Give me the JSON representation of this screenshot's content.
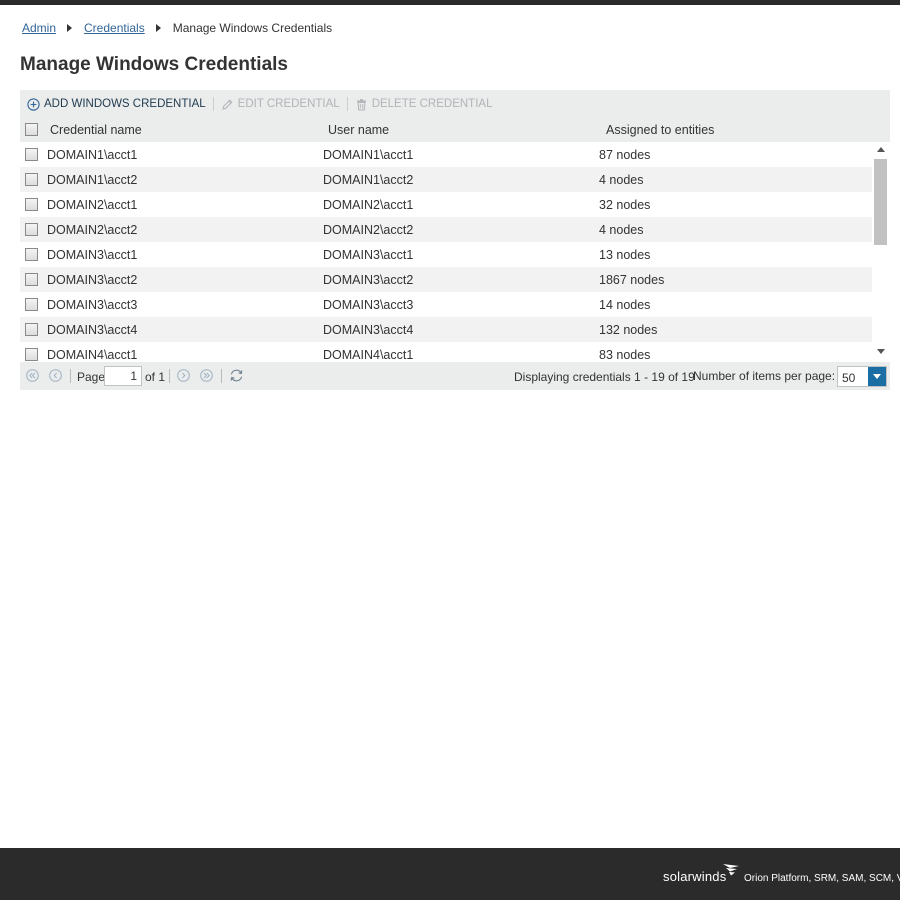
{
  "breadcrumb": {
    "items": [
      "Admin",
      "Credentials"
    ],
    "current": "Manage Windows Credentials"
  },
  "page_title": "Manage Windows Credentials",
  "toolbar": {
    "add_label": "ADD WINDOWS CREDENTIAL",
    "edit_label": "EDIT CREDENTIAL",
    "delete_label": "DELETE CREDENTIAL"
  },
  "columns": [
    "Credential name",
    "User name",
    "Assigned to entities"
  ],
  "rows": [
    {
      "credential": "DOMAIN1\\acct1",
      "user": "DOMAIN1\\acct1",
      "assigned": "87 nodes"
    },
    {
      "credential": "DOMAIN1\\acct2",
      "user": "DOMAIN1\\acct2",
      "assigned": "4 nodes"
    },
    {
      "credential": "DOMAIN2\\acct1",
      "user": "DOMAIN2\\acct1",
      "assigned": "32 nodes"
    },
    {
      "credential": "DOMAIN2\\acct2",
      "user": "DOMAIN2\\acct2",
      "assigned": "4 nodes"
    },
    {
      "credential": "DOMAIN3\\acct1",
      "user": "DOMAIN3\\acct1",
      "assigned": "13 nodes"
    },
    {
      "credential": "DOMAIN3\\acct2",
      "user": "DOMAIN3\\acct2",
      "assigned": "1867 nodes"
    },
    {
      "credential": "DOMAIN3\\acct3",
      "user": "DOMAIN3\\acct3",
      "assigned": "14 nodes"
    },
    {
      "credential": "DOMAIN3\\acct4",
      "user": "DOMAIN3\\acct4",
      "assigned": "132 nodes"
    },
    {
      "credential": "DOMAIN4\\acct1",
      "user": "DOMAIN4\\acct1",
      "assigned": "83 nodes"
    }
  ],
  "pager": {
    "page_label": "Page",
    "page_value": "1",
    "of_label": "of 1",
    "display_info": "Displaying credentials 1 - 19 of 19",
    "per_page_label": "Number of items per page:",
    "per_page_value": "50"
  },
  "footer": {
    "brand": "solarwinds",
    "products": "Orion Platform, SRM, SAM, SCM, VMA"
  },
  "colors": {
    "accent": "#1b6ea3",
    "link": "#336699",
    "footer_bg": "#2b2b2b",
    "grid_bg": "#ebecec"
  }
}
